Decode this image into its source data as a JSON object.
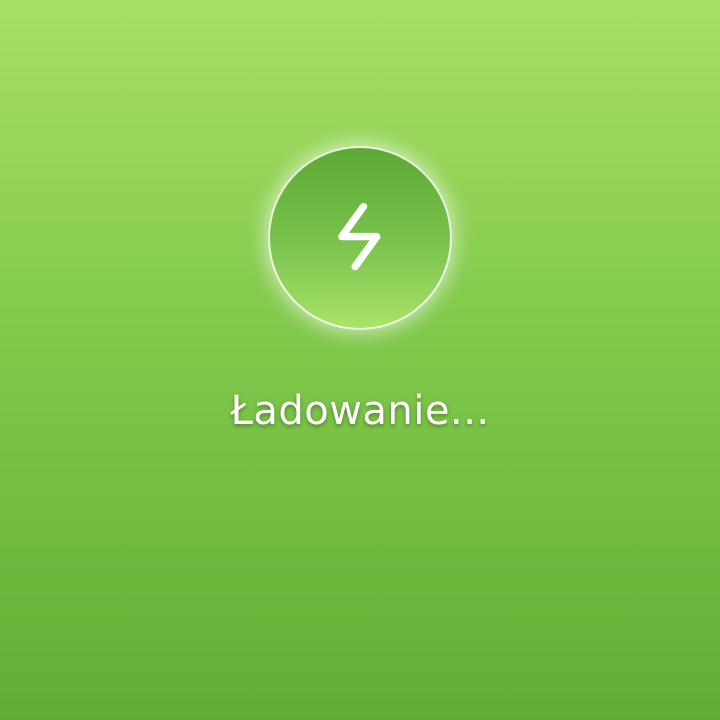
{
  "screen": {
    "status_text": "Ładowanie..."
  },
  "badge": {
    "icon": "lightning-bolt-icon"
  },
  "colors": {
    "background_top": "#a8e063",
    "background_bottom": "#5fae34",
    "badge_fill_top": "#5ca934",
    "badge_fill_bottom": "#a9e36a",
    "foreground": "#ffffff"
  }
}
